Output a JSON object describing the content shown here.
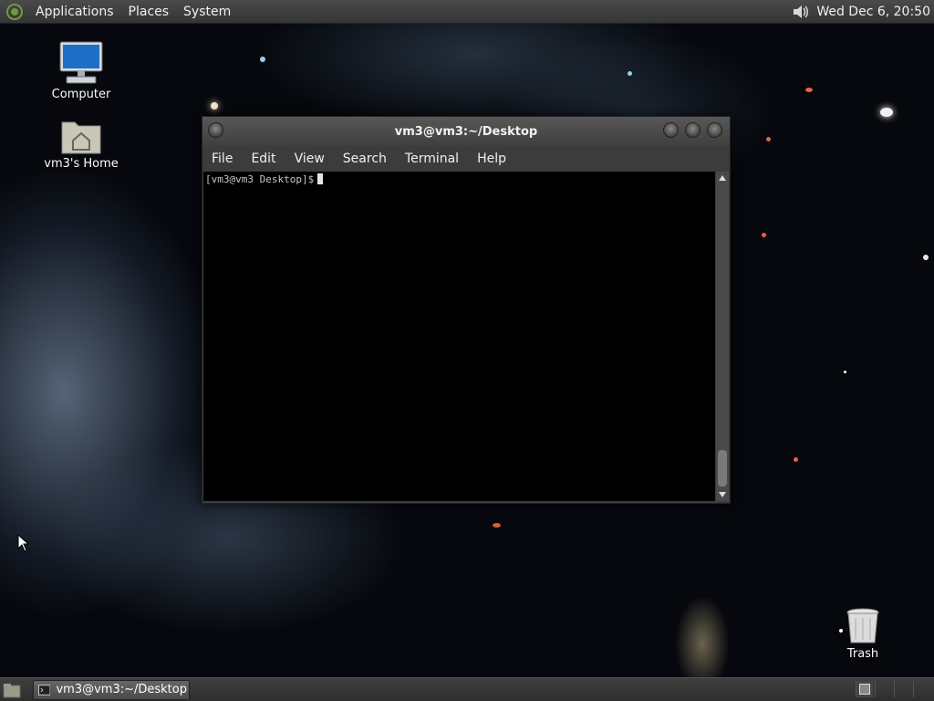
{
  "top_panel": {
    "menus": [
      "Applications",
      "Places",
      "System"
    ],
    "clock": "Wed Dec  6, 20:50",
    "icons": [
      "distro-logo-icon",
      "volume-icon"
    ]
  },
  "desktop": {
    "icons": [
      {
        "label": "Computer",
        "icon": "computer-icon"
      },
      {
        "label": "vm3's Home",
        "icon": "home-folder-icon"
      },
      {
        "label": "Trash",
        "icon": "trash-icon"
      }
    ]
  },
  "window": {
    "title": "vm3@vm3:~/Desktop",
    "menu": [
      "File",
      "Edit",
      "View",
      "Search",
      "Terminal",
      "Help"
    ],
    "prompt": "[vm3@vm3 Desktop]$"
  },
  "bottom_panel": {
    "task_label": "vm3@vm3:~/Desktop",
    "icons": [
      "show-desktop-icon",
      "terminal-icon"
    ]
  },
  "colors": {
    "terminal_bg": "#000000",
    "panel_bg": "#3c3c3c"
  }
}
